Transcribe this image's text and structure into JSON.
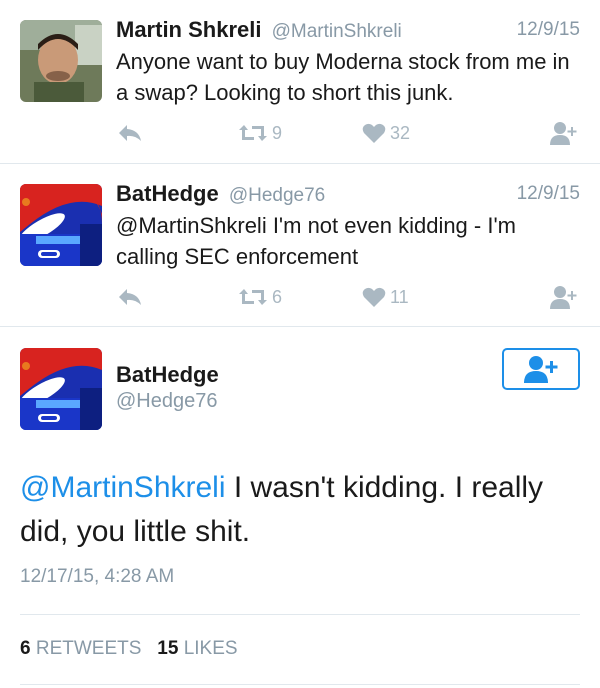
{
  "tweets": [
    {
      "name": "Martin Shkreli",
      "handle": "@MartinShkreli",
      "date": "12/9/15",
      "text": "Anyone want to buy Moderna stock from me in a swap? Looking to short this junk.",
      "retweets": "9",
      "likes": "32"
    },
    {
      "name": "BatHedge",
      "handle": "@Hedge76",
      "date": "12/9/15",
      "text": "@MartinShkreli I'm not even kidding - I'm calling SEC enforcement",
      "retweets": "6",
      "likes": "11"
    }
  ],
  "main": {
    "name": "BatHedge",
    "handle": "@Hedge76",
    "mention": "@MartinShkreli",
    "text": " I wasn't kidding.  I really did, you little shit.",
    "timestamp": "12/17/15, 4:28 AM",
    "retweet_count": "6",
    "retweet_label": "RETWEETS",
    "like_count": "15",
    "like_label": "LIKES"
  },
  "colors": {
    "link": "#1d8fe8",
    "muted": "#8899a6",
    "icon": "#aab8c2"
  },
  "icons": [
    "reply-icon",
    "retweet-icon",
    "heart-icon",
    "follow-user-icon"
  ]
}
